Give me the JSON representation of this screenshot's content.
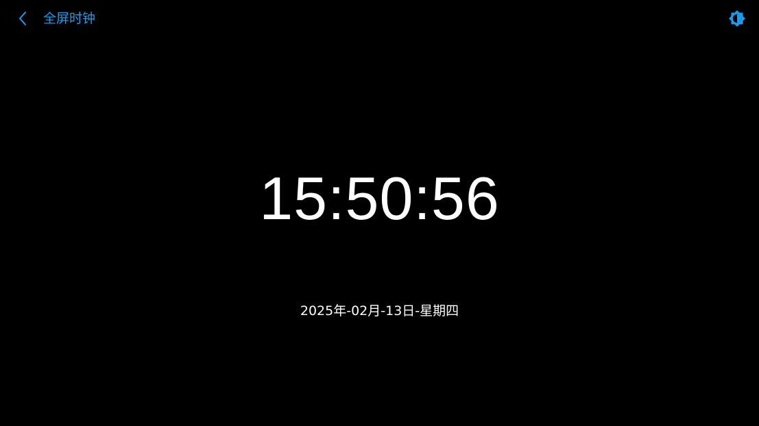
{
  "header": {
    "back_icon": "chevron-left-icon",
    "title": "全屏时钟",
    "brightness_icon": "brightness-icon"
  },
  "clock": {
    "time": "15:50:56",
    "date": "2025年-02月-13日-星期四"
  },
  "colors": {
    "background": "#000000",
    "accent": "#1a9cf0",
    "text": "#ffffff"
  }
}
